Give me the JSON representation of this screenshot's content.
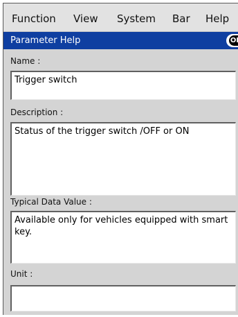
{
  "menu": {
    "items": [
      "Function",
      "View",
      "System",
      "Bar",
      "Help"
    ]
  },
  "window": {
    "title": "Parameter Help",
    "ok_label": "OK"
  },
  "fields": {
    "name": {
      "label": "Name :",
      "value": "Trigger switch"
    },
    "description": {
      "label": "Description :",
      "value": "Status of the trigger switch /OFF or ON"
    },
    "typical_value": {
      "label": "Typical Data Value :",
      "value": "Available only for vehicles equipped with smart key."
    },
    "unit": {
      "label": "Unit :",
      "value": ""
    }
  },
  "colors": {
    "titlebar": "#0f3fa1",
    "menubar": "#e2e2e2",
    "panel": "#d4d4d4"
  }
}
